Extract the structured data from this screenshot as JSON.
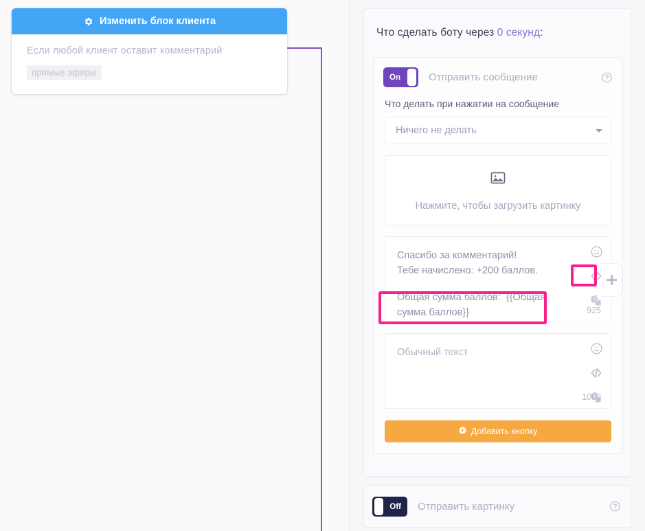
{
  "left_flow": {
    "client_block": {
      "header_title": "Изменить блок клиента",
      "header_icon": "gear-icon",
      "condition_text": "Если любой клиент оставит комментарий",
      "chip_text": "прямые эфиры"
    }
  },
  "right_panel": {
    "title_prefix": "Что сделать боту через",
    "title_seconds": "0 секунд",
    "title_suffix": ":",
    "actions": [
      {
        "toggle_state": "On",
        "name": "Отправить сообщение",
        "help_icon": "question-circle-icon",
        "click_label": "Что делать при нажатии на сообщение",
        "select_value": "Ничего не делать",
        "upload_text": "Нажмите, чтобы загрузить картинку",
        "upload_icon": "image-placeholder-icon",
        "message_body": "Спасибо за комментарий!\nТебе начислено: +200 баллов.",
        "message_variable_line": "Общая сумма баллов:  {{Общая сумма баллов}}",
        "message_char_count": "925",
        "second_field_placeholder": "Обычный текст",
        "second_char_count": "1000",
        "tools": [
          "emoji-icon",
          "code-icon",
          "variable-icon"
        ],
        "add_button_label": "Добавить кнопку",
        "add_button_icon": "plus-circle-icon"
      },
      {
        "toggle_state": "Off",
        "name": "Отправить картинку",
        "help_icon": "question-circle-icon"
      }
    ],
    "edge_add_tab_icon": "plus-icon"
  },
  "colors": {
    "header_blue": "#42a5f5",
    "toggle_on_purple": "#7044bd",
    "toggle_off_navy": "#1f2547",
    "accent_orange": "#f7a941",
    "highlight_magenta": "#f81f8f",
    "connector_purple": "#8b4fc7",
    "seconds_purple": "#8b6fd6"
  }
}
